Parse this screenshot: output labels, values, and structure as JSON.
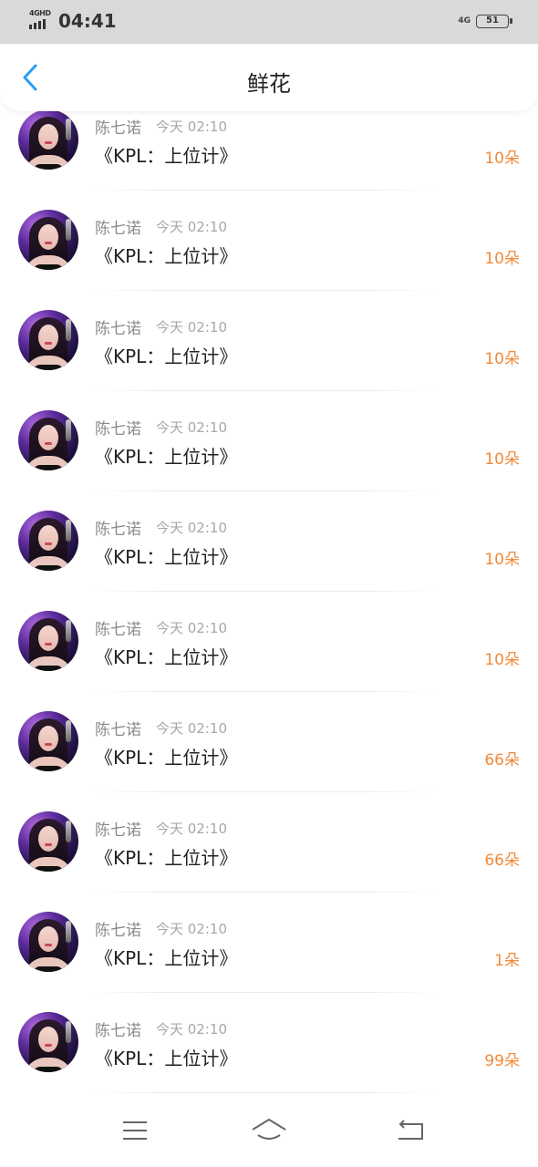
{
  "status_bar": {
    "network_left": "4GHD",
    "time": "04:41",
    "network_right": "4G",
    "battery": "51"
  },
  "header": {
    "title": "鲜花",
    "back_icon": "chevron-left-icon",
    "accent_color": "#2a9df4"
  },
  "items": [
    {
      "name": "陈七诺",
      "time": "今天 02:10",
      "book": "《KPL：上位计》",
      "count": "10朵"
    },
    {
      "name": "陈七诺",
      "time": "今天 02:10",
      "book": "《KPL：上位计》",
      "count": "10朵"
    },
    {
      "name": "陈七诺",
      "time": "今天 02:10",
      "book": "《KPL：上位计》",
      "count": "10朵"
    },
    {
      "name": "陈七诺",
      "time": "今天 02:10",
      "book": "《KPL：上位计》",
      "count": "10朵"
    },
    {
      "name": "陈七诺",
      "time": "今天 02:10",
      "book": "《KPL：上位计》",
      "count": "10朵"
    },
    {
      "name": "陈七诺",
      "time": "今天 02:10",
      "book": "《KPL：上位计》",
      "count": "10朵"
    },
    {
      "name": "陈七诺",
      "time": "今天 02:10",
      "book": "《KPL：上位计》",
      "count": "66朵"
    },
    {
      "name": "陈七诺",
      "time": "今天 02:10",
      "book": "《KPL：上位计》",
      "count": "66朵"
    },
    {
      "name": "陈七诺",
      "time": "今天 02:10",
      "book": "《KPL：上位计》",
      "count": "1朵"
    },
    {
      "name": "陈七诺",
      "time": "今天 02:10",
      "book": "《KPL：上位计》",
      "count": "99朵"
    }
  ],
  "colors": {
    "count": "#f08a3a",
    "name": "#8a8a8a",
    "status_bar_bg": "#d9d9d9"
  },
  "nav_bar": {
    "icons": [
      "menu-icon",
      "home-icon",
      "back-icon"
    ]
  }
}
